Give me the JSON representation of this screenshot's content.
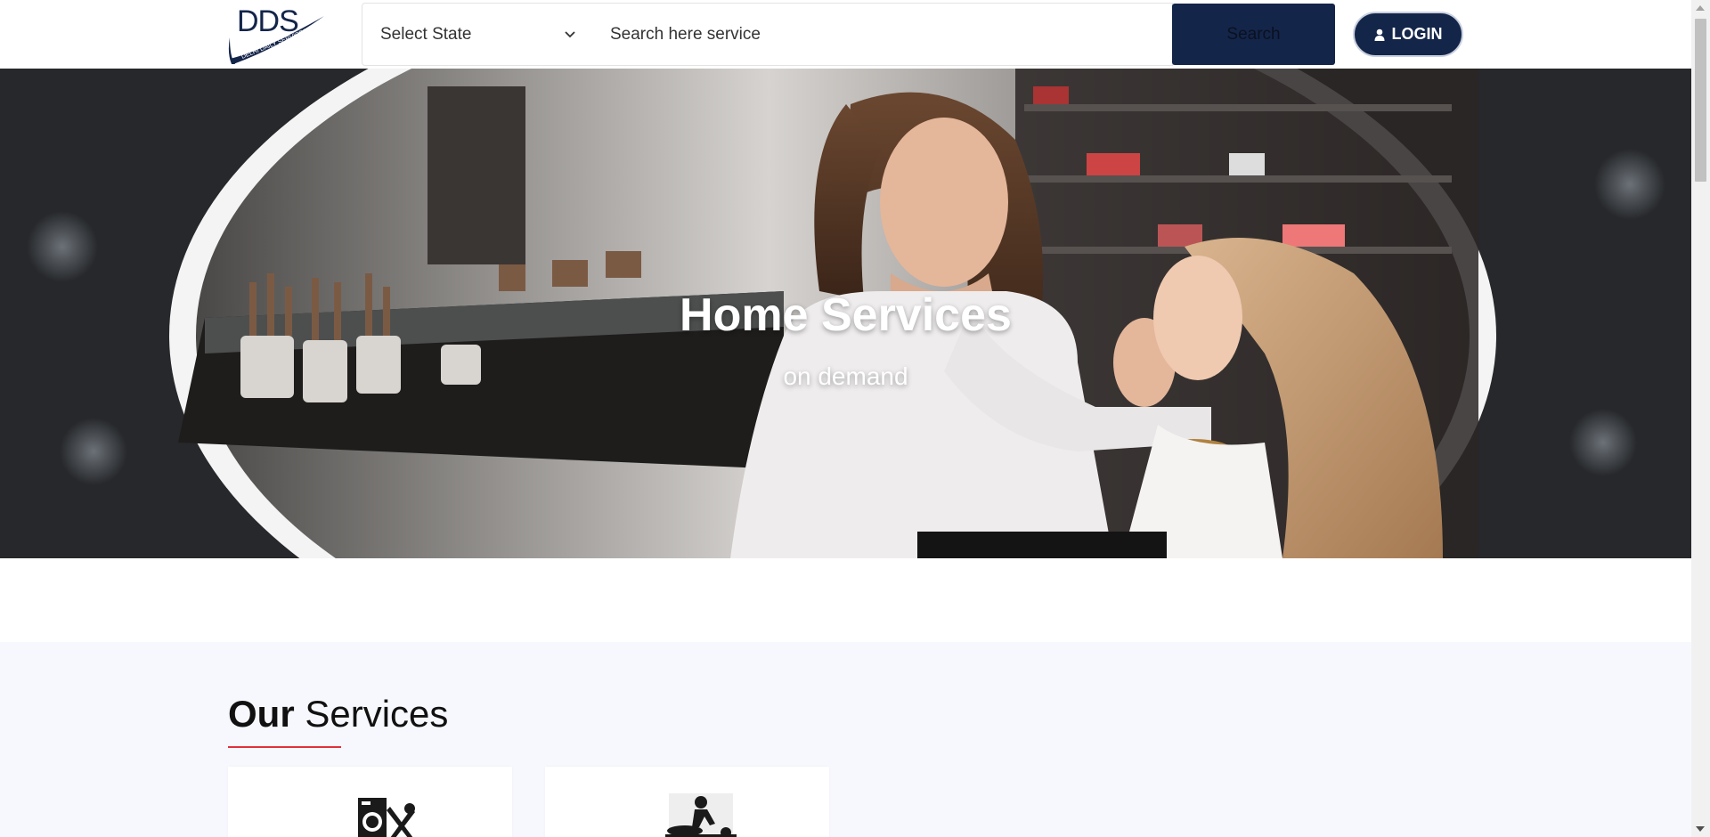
{
  "header": {
    "logo": {
      "brand": "DDS",
      "tagline": "DELHI DAILY SERVICES"
    },
    "state_select": {
      "selected": "Select State"
    },
    "search": {
      "placeholder": "Search here service"
    },
    "search_button_label": "Search",
    "login_button_label": "LOGIN"
  },
  "hero": {
    "title": "Home Services",
    "subtitle": "on demand"
  },
  "services": {
    "heading_bold": "Our",
    "heading_rest": "Services",
    "cards": [
      {
        "icon": "appliance-repair-icon"
      },
      {
        "icon": "massage-icon"
      }
    ]
  },
  "colors": {
    "navy": "#14254a",
    "accent_red": "#e0303a",
    "section_bg": "#f7f8fd"
  }
}
